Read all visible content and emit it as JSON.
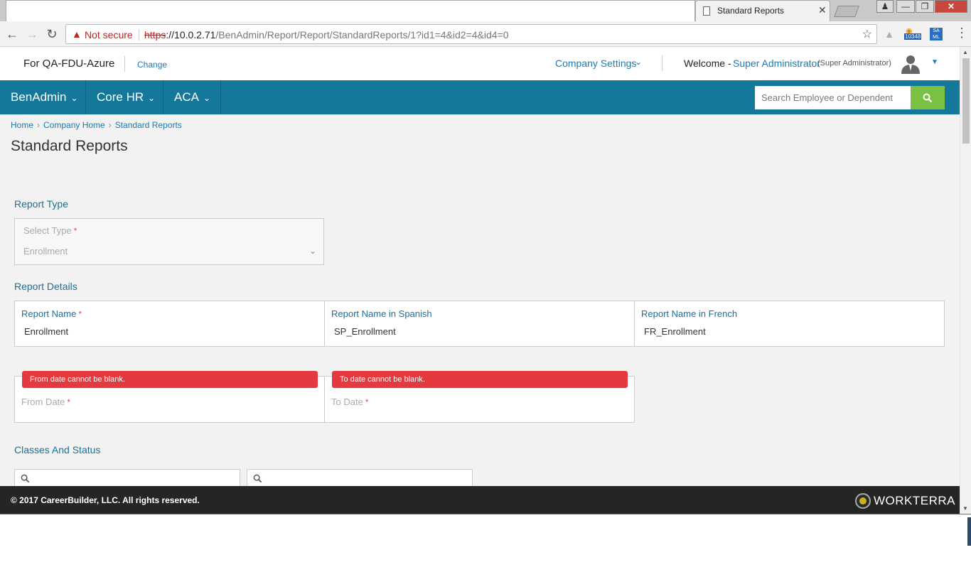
{
  "browser": {
    "tab_title": "Standard Reports",
    "tab_close": "✕",
    "security_label": "Not secure",
    "url_scheme": "https",
    "url_host": "://10.0.2.71",
    "url_path": "/BenAdmin/Report/Report/StandardReports/1?id1=4&id2=4&id4=0",
    "extension_badge": "10348"
  },
  "header": {
    "company_name": "For QA-FDU-Azure",
    "change_label": "Change",
    "company_settings_label": "Company Settings",
    "welcome_label": "Welcome -",
    "user_name": "Super Administrator",
    "user_role": "(Super Administrator)"
  },
  "nav": {
    "items": [
      {
        "label": "BenAdmin"
      },
      {
        "label": "Core HR"
      },
      {
        "label": "ACA"
      }
    ],
    "search_placeholder": "Search Employee or Dependent"
  },
  "breadcrumb": [
    "Home",
    "Company Home",
    "Standard Reports"
  ],
  "page_title": "Standard Reports",
  "report_type": {
    "section_label": "Report Type",
    "select_label": "Select Type",
    "select_value": "Enrollment"
  },
  "report_details": {
    "section_label": "Report Details",
    "fields": [
      {
        "label": "Report Name",
        "value": "Enrollment"
      },
      {
        "label": "Report Name in Spanish",
        "value": "SP_Enrollment"
      },
      {
        "label": "Report Name in French",
        "value": "FR_Enrollment"
      }
    ]
  },
  "dates": {
    "from_label": "From Date",
    "from_error": "From date cannot be blank.",
    "to_label": "To Date",
    "to_error": "To date cannot be blank."
  },
  "classes": {
    "section_label": "Classes And Status"
  },
  "footer": {
    "copyright": "© 2017 CareerBuilder, LLC. All rights reserved.",
    "logo_text": "WORKTERRA"
  },
  "colors": {
    "nav_bg": "#13789a",
    "search_btn": "#7ac142",
    "error": "#e3393f",
    "link": "#1a7bb2"
  }
}
